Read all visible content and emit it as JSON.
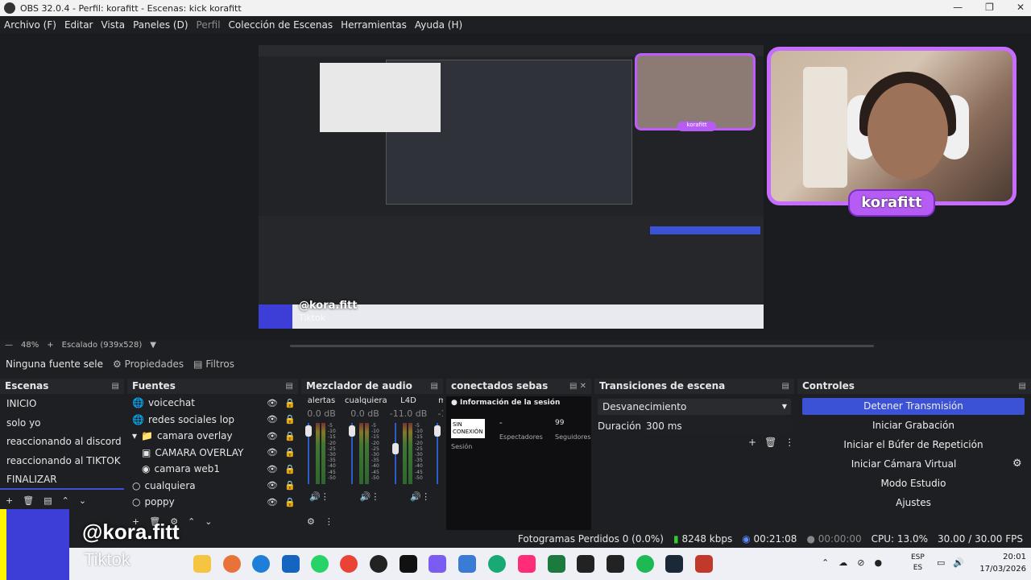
{
  "window": {
    "title": "OBS 32.0.4 - Perfil: korafitt - Escenas: kick korafitt"
  },
  "menu": [
    "Archivo (F)",
    "Editar",
    "Vista",
    "Paneles (D)",
    "Perfil",
    "Colección de Escenas",
    "Herramientas",
    "Ayuda (H)"
  ],
  "preview": {
    "zoom": "48%",
    "scale": "Escalado (939x528)",
    "webcam_label": "korafitt",
    "overlay_handle": "@kora.fitt",
    "overlay_sub": "Tiktok"
  },
  "propbar": {
    "no_source": "Ninguna fuente sele",
    "properties": "Propiedades",
    "filters": "Filtros"
  },
  "scenes": {
    "title": "Escenas",
    "items": [
      "INICIO",
      "solo yo",
      "reaccionando al discord",
      "reaccionando al TIKTOK",
      "FINALIZAR"
    ]
  },
  "sources": {
    "title": "Fuentes",
    "items": [
      "voicechat",
      "redes sociales lop",
      "camara overlay",
      "CAMARA OVERLAY",
      "camara web1",
      "cualquiera",
      "poppy"
    ]
  },
  "mixer": {
    "title": "Mezclador de audio",
    "channels": [
      {
        "name": "alertas",
        "db": "0.0 dB"
      },
      {
        "name": "cualquiera",
        "db": "0.0 dB"
      },
      {
        "name": "L4D",
        "db": "-11.0 dB"
      },
      {
        "name": "m",
        "db": "-1"
      }
    ]
  },
  "connected": {
    "title": "conectados sebas",
    "session_info": "Información de la sesión",
    "status": "SIN CONEXIÓN",
    "spectators_value": "-",
    "spectators_label": "Espectadores",
    "followers_value": "99",
    "followers_label": "Seguidores",
    "session_label": "Sesión"
  },
  "transitions": {
    "title": "Transiciones de escena",
    "selected": "Desvanecimiento",
    "duration_label": "Duración",
    "duration_value": "300 ms"
  },
  "controls": {
    "title": "Controles",
    "buttons": [
      "Detener Transmisión",
      "Iniciar Grabación",
      "Iniciar el Búfer de Repetición",
      "Iniciar Cámara Virtual",
      "Modo Estudio",
      "Ajustes"
    ]
  },
  "status": {
    "dropped": "Fotogramas Perdidos 0 (0.0%)",
    "bitrate": "8248 kbps",
    "stream_time": "00:21:08",
    "rec_time": "00:00:00",
    "cpu": "CPU: 13.0%",
    "fps": "30.00 / 30.00 FPS"
  },
  "taskbar": {
    "lang_1": "ESP",
    "lang_2": "ES",
    "time": "20:01",
    "date": "17/03/2026"
  },
  "colors": {
    "accent": "#3b52d6",
    "overlay_purple": "#c66cff"
  }
}
